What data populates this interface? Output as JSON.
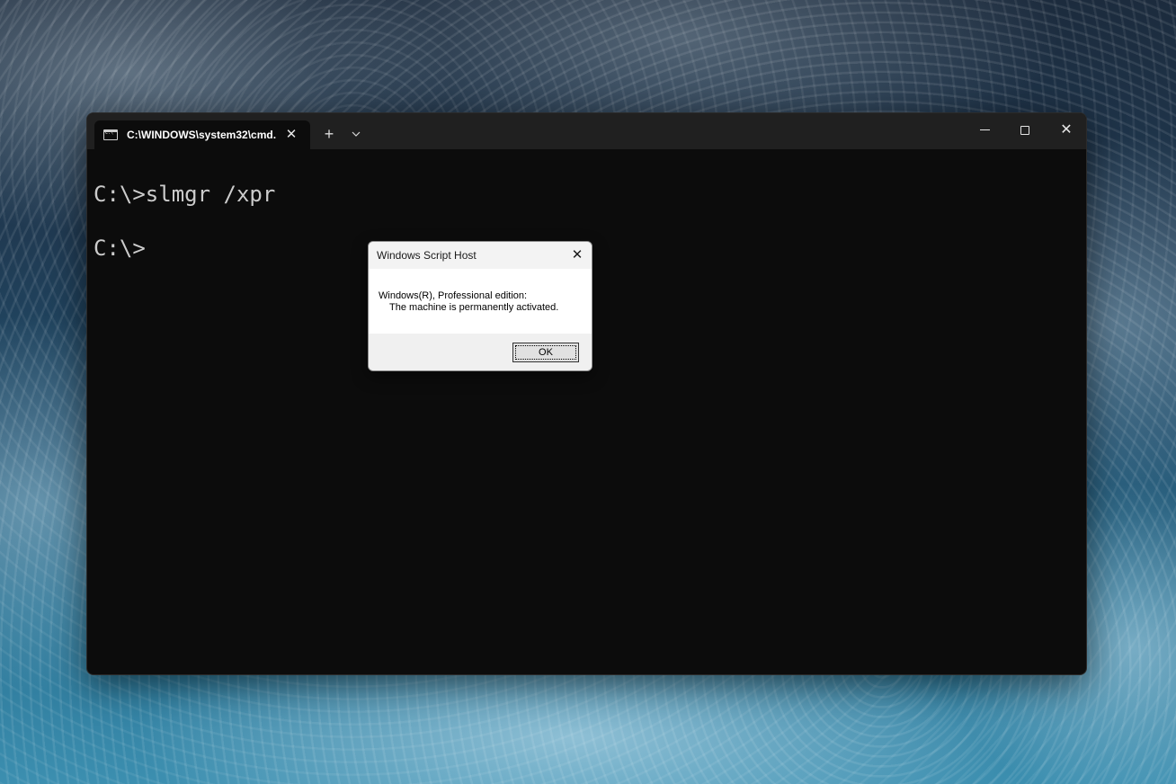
{
  "terminal": {
    "tab_title": "C:\\WINDOWS\\system32\\cmd.",
    "tab_close_glyph": "✕",
    "new_tab_glyph": "+",
    "dropdown_glyph": "⌄",
    "close_glyph": "✕",
    "console_lines": [
      "C:\\>slmgr /xpr",
      "C:\\>"
    ]
  },
  "dialog": {
    "title": "Windows Script Host",
    "close_glyph": "✕",
    "message_line1": "Windows(R), Professional edition:",
    "message_line2": "    The machine is permanently activated.",
    "ok_label": "OK"
  },
  "icons": {
    "tab": "command-prompt-icon",
    "minimize": "minimize-icon",
    "maximize": "maximize-icon",
    "close": "close-icon"
  }
}
